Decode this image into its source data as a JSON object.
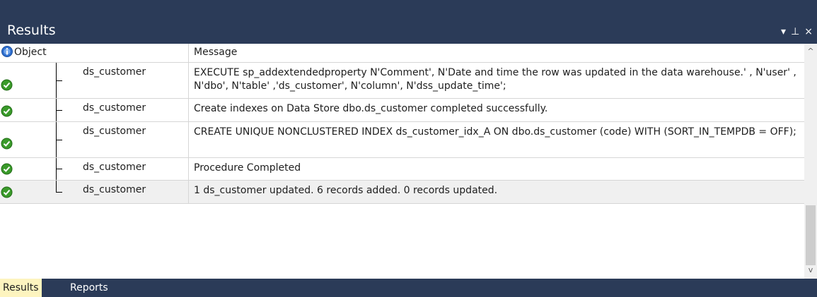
{
  "panel": {
    "title": "Results",
    "menu_glyph": "▾",
    "pin_glyph": "⊥",
    "close_glyph": "×"
  },
  "grid": {
    "columns": [
      "Object",
      "Message"
    ],
    "rows": [
      {
        "object": "ds_customer",
        "message": "EXECUTE sp_addextendedproperty N'Comment', N'Date and time the row was updated in the data warehouse.' , N'user' , N'dbo', N'table' ,'ds_customer', N'column', N'dss_update_time';",
        "status_icon": "success-check-icon"
      },
      {
        "object": "ds_customer",
        "message": "Create indexes on Data Store dbo.ds_customer completed successfully.",
        "status_icon": "success-check-icon"
      },
      {
        "object": "ds_customer",
        "message": "CREATE UNIQUE NONCLUSTERED INDEX ds_customer_idx_A ON dbo.ds_customer  (code) WITH (SORT_IN_TEMPDB = OFF);",
        "status_icon": "success-check-icon"
      },
      {
        "object": "ds_customer",
        "message": "Procedure Completed",
        "status_icon": "success-check-icon"
      },
      {
        "object": "ds_customer",
        "message": "1  ds_customer updated. 6 records added. 0 records updated.",
        "status_icon": "success-check-icon"
      }
    ]
  },
  "scrollbar": {
    "up": "^",
    "down": "v"
  },
  "tabs": [
    "Results",
    "Reports"
  ],
  "colors": {
    "chrome": "#2b3b58",
    "active_tab": "#fdf4bf",
    "success": "#3a9a2a"
  }
}
